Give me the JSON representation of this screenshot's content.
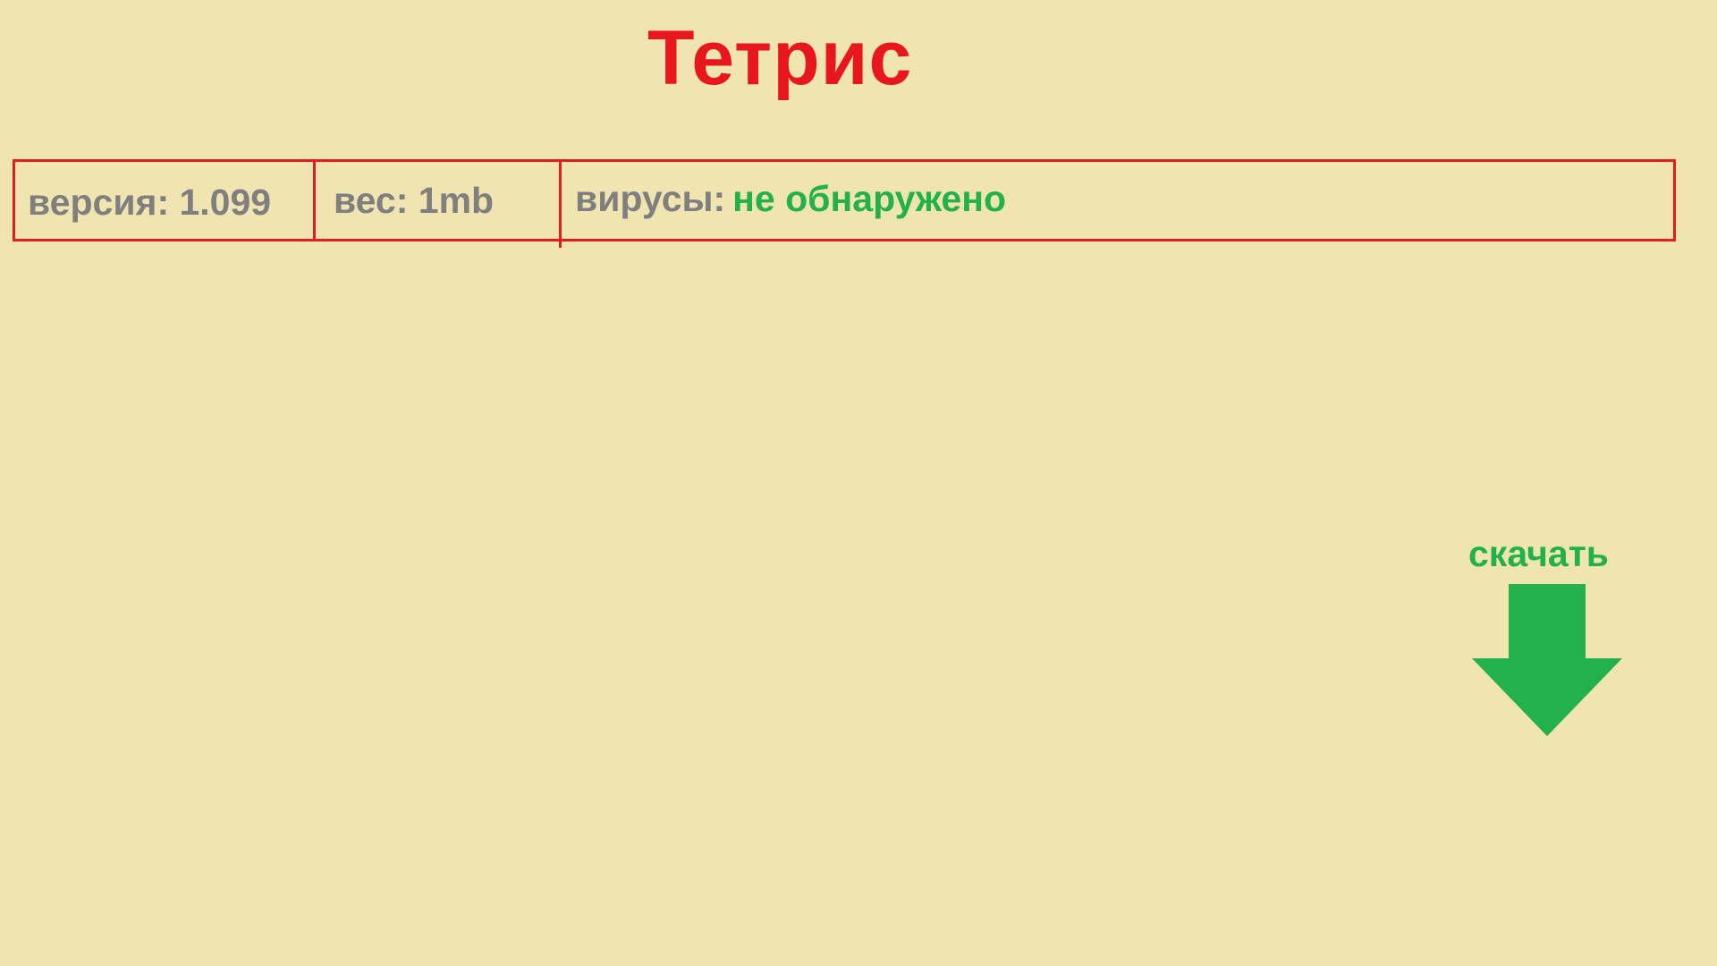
{
  "header": {
    "title": "Тетрис"
  },
  "info": {
    "version": "версия: 1.099",
    "weight": "вес: 1mb",
    "viruses_label": "вирусы:",
    "viruses_status": "не обнаружено"
  },
  "download": {
    "label": "скачать",
    "icon": "download-arrow-icon"
  },
  "colors": {
    "background": "#F0E4B0",
    "title": "#E8171E",
    "border": "#E21C23",
    "info_text": "#7F7F7F",
    "accent_green": "#22B14C"
  }
}
